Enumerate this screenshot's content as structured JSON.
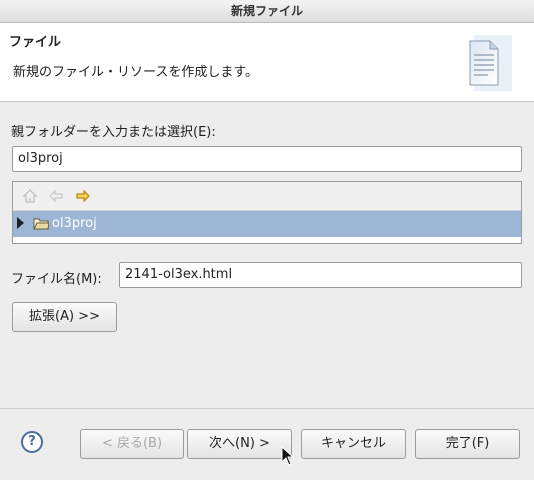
{
  "window": {
    "title": "新規ファイル"
  },
  "banner": {
    "title": "ファイル",
    "description": "新規のファイル・リソースを作成します。",
    "icon": "new-file-icon"
  },
  "parent_folder": {
    "label": "親フォルダーを入力または選択(E):",
    "value": "ol3proj",
    "toolbar": {
      "home_icon": "home-icon",
      "back_icon": "back-arrow-icon",
      "forward_icon": "forward-arrow-icon"
    },
    "tree": [
      {
        "label": "ol3proj",
        "selected": true,
        "expanded": false,
        "icon": "project-folder-icon"
      }
    ]
  },
  "file_name": {
    "label": "ファイル名(M):",
    "value": "2141-ol3ex.html"
  },
  "advanced_button": "拡張(A) >>",
  "footer": {
    "help_icon": "help-icon",
    "back_button": "< 戻る(B)",
    "next_button": "次へ(N) >",
    "cancel_button": "キャンセル",
    "finish_button": "完了(F)"
  }
}
